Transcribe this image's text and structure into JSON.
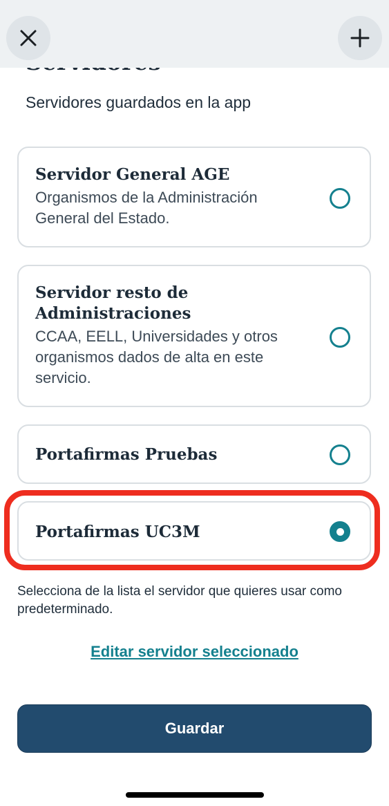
{
  "header": {
    "close_icon": "close-icon",
    "add_icon": "plus-icon"
  },
  "page": {
    "title": "Servidores",
    "subtitle": "Servidores guardados en la app"
  },
  "servers": [
    {
      "title": "Servidor General AGE",
      "description": "Organismos de la Administración General del Estado.",
      "selected": false
    },
    {
      "title": "Servidor resto de Administraciones",
      "description": "CCAA, EELL, Universidades y otros organismos dados de alta en este servicio.",
      "selected": false
    },
    {
      "title": "Portafirmas Pruebas",
      "description": "",
      "selected": false
    },
    {
      "title": "Portafirmas UC3M",
      "description": "",
      "selected": true
    }
  ],
  "hint": "Selecciona de la lista el servidor que quieres usar como predeterminado.",
  "edit_link": "Editar servidor seleccionado",
  "save_label": "Guardar",
  "colors": {
    "accent": "#14808e",
    "primary_button": "#224b6e",
    "highlight": "#ee2d1f"
  }
}
